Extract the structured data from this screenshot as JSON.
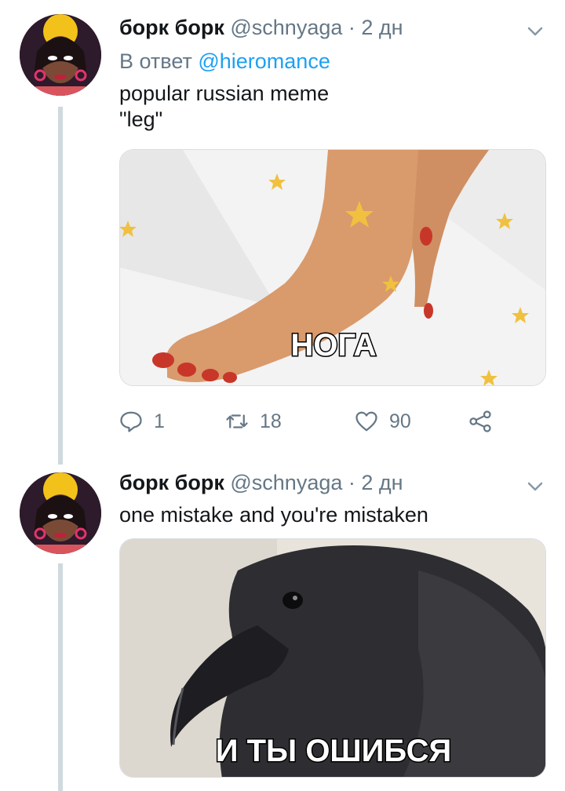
{
  "tweets": [
    {
      "display_name": "борк борк",
      "handle": "@schnyaga",
      "separator": "·",
      "time": "2 дн",
      "reply_prefix": "В ответ",
      "reply_mention": "@hieromance",
      "text": "popular russian meme\n\"leg\"",
      "media_caption": "НОГА",
      "avatar_icon": "user-avatar",
      "actions": {
        "replies": "1",
        "retweets": "18",
        "likes": "90"
      }
    },
    {
      "display_name": "борк борк",
      "handle": "@schnyaga",
      "separator": "·",
      "time": "2 дн",
      "text": "one mistake and you're mistaken",
      "media_caption": "И ТЫ ОШИБСЯ",
      "avatar_icon": "user-avatar"
    }
  ],
  "colors": {
    "link": "#1da1f2",
    "secondary_text": "#657786",
    "thread_line": "#cfd9de"
  }
}
